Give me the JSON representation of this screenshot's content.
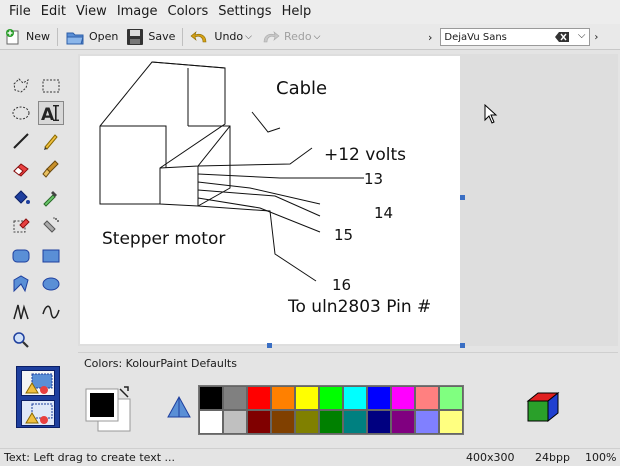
{
  "menu": {
    "items": [
      {
        "label": "File"
      },
      {
        "label": "Edit"
      },
      {
        "label": "View"
      },
      {
        "label": "Image"
      },
      {
        "label": "Colors"
      },
      {
        "label": "Settings"
      },
      {
        "label": "Help"
      }
    ]
  },
  "toolbar": {
    "new_label": "New",
    "open_label": "Open",
    "save_label": "Save",
    "undo_label": "Undo",
    "redo_label": "Redo",
    "font_value": "DejaVu Sans"
  },
  "canvas": {
    "texts": {
      "cable": "Cable",
      "volts": "+12 volts",
      "n13": "13",
      "n14": "14",
      "n15": "15",
      "n16": "16",
      "stepper": "Stepper motor",
      "uln": "To uln2803 Pin #"
    }
  },
  "palette": {
    "title": "Colors: KolourPaint Defaults",
    "row1": [
      "#000000",
      "#808080",
      "#ff0000",
      "#ff8000",
      "#ffff00",
      "#00ff00",
      "#00ffff",
      "#0000ff",
      "#ff00ff",
      "#ff8080",
      "#80ff80"
    ],
    "row2": [
      "#ffffff",
      "#c0c0c0",
      "#800000",
      "#804000",
      "#808000",
      "#008000",
      "#008080",
      "#000080",
      "#800080",
      "#8080ff",
      "#ffff80"
    ]
  },
  "status": {
    "text": "Text: Left drag to create text ...",
    "size": "400x300",
    "bpp": "24bpp",
    "zoom": "100%"
  },
  "colors": {
    "accent": "#3a6fc4",
    "toolbox_blue": "#1e3f9e"
  }
}
